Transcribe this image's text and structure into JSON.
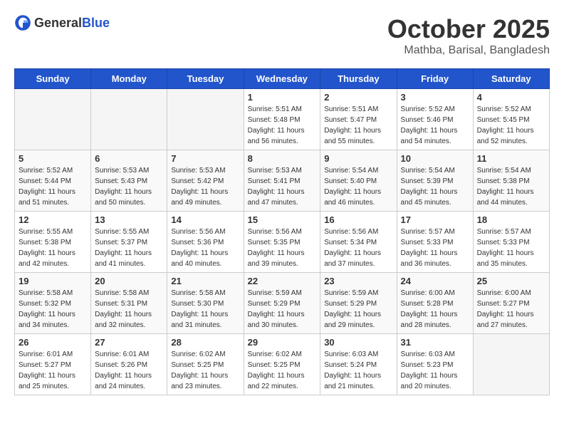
{
  "header": {
    "logo_general": "General",
    "logo_blue": "Blue",
    "month_year": "October 2025",
    "location": "Mathba, Barisal, Bangladesh"
  },
  "days_of_week": [
    "Sunday",
    "Monday",
    "Tuesday",
    "Wednesday",
    "Thursday",
    "Friday",
    "Saturday"
  ],
  "weeks": [
    [
      {
        "day": "",
        "info": ""
      },
      {
        "day": "",
        "info": ""
      },
      {
        "day": "",
        "info": ""
      },
      {
        "day": "1",
        "info": "Sunrise: 5:51 AM\nSunset: 5:48 PM\nDaylight: 11 hours\nand 56 minutes."
      },
      {
        "day": "2",
        "info": "Sunrise: 5:51 AM\nSunset: 5:47 PM\nDaylight: 11 hours\nand 55 minutes."
      },
      {
        "day": "3",
        "info": "Sunrise: 5:52 AM\nSunset: 5:46 PM\nDaylight: 11 hours\nand 54 minutes."
      },
      {
        "day": "4",
        "info": "Sunrise: 5:52 AM\nSunset: 5:45 PM\nDaylight: 11 hours\nand 52 minutes."
      }
    ],
    [
      {
        "day": "5",
        "info": "Sunrise: 5:52 AM\nSunset: 5:44 PM\nDaylight: 11 hours\nand 51 minutes."
      },
      {
        "day": "6",
        "info": "Sunrise: 5:53 AM\nSunset: 5:43 PM\nDaylight: 11 hours\nand 50 minutes."
      },
      {
        "day": "7",
        "info": "Sunrise: 5:53 AM\nSunset: 5:42 PM\nDaylight: 11 hours\nand 49 minutes."
      },
      {
        "day": "8",
        "info": "Sunrise: 5:53 AM\nSunset: 5:41 PM\nDaylight: 11 hours\nand 47 minutes."
      },
      {
        "day": "9",
        "info": "Sunrise: 5:54 AM\nSunset: 5:40 PM\nDaylight: 11 hours\nand 46 minutes."
      },
      {
        "day": "10",
        "info": "Sunrise: 5:54 AM\nSunset: 5:39 PM\nDaylight: 11 hours\nand 45 minutes."
      },
      {
        "day": "11",
        "info": "Sunrise: 5:54 AM\nSunset: 5:38 PM\nDaylight: 11 hours\nand 44 minutes."
      }
    ],
    [
      {
        "day": "12",
        "info": "Sunrise: 5:55 AM\nSunset: 5:38 PM\nDaylight: 11 hours\nand 42 minutes."
      },
      {
        "day": "13",
        "info": "Sunrise: 5:55 AM\nSunset: 5:37 PM\nDaylight: 11 hours\nand 41 minutes."
      },
      {
        "day": "14",
        "info": "Sunrise: 5:56 AM\nSunset: 5:36 PM\nDaylight: 11 hours\nand 40 minutes."
      },
      {
        "day": "15",
        "info": "Sunrise: 5:56 AM\nSunset: 5:35 PM\nDaylight: 11 hours\nand 39 minutes."
      },
      {
        "day": "16",
        "info": "Sunrise: 5:56 AM\nSunset: 5:34 PM\nDaylight: 11 hours\nand 37 minutes."
      },
      {
        "day": "17",
        "info": "Sunrise: 5:57 AM\nSunset: 5:33 PM\nDaylight: 11 hours\nand 36 minutes."
      },
      {
        "day": "18",
        "info": "Sunrise: 5:57 AM\nSunset: 5:33 PM\nDaylight: 11 hours\nand 35 minutes."
      }
    ],
    [
      {
        "day": "19",
        "info": "Sunrise: 5:58 AM\nSunset: 5:32 PM\nDaylight: 11 hours\nand 34 minutes."
      },
      {
        "day": "20",
        "info": "Sunrise: 5:58 AM\nSunset: 5:31 PM\nDaylight: 11 hours\nand 32 minutes."
      },
      {
        "day": "21",
        "info": "Sunrise: 5:58 AM\nSunset: 5:30 PM\nDaylight: 11 hours\nand 31 minutes."
      },
      {
        "day": "22",
        "info": "Sunrise: 5:59 AM\nSunset: 5:29 PM\nDaylight: 11 hours\nand 30 minutes."
      },
      {
        "day": "23",
        "info": "Sunrise: 5:59 AM\nSunset: 5:29 PM\nDaylight: 11 hours\nand 29 minutes."
      },
      {
        "day": "24",
        "info": "Sunrise: 6:00 AM\nSunset: 5:28 PM\nDaylight: 11 hours\nand 28 minutes."
      },
      {
        "day": "25",
        "info": "Sunrise: 6:00 AM\nSunset: 5:27 PM\nDaylight: 11 hours\nand 27 minutes."
      }
    ],
    [
      {
        "day": "26",
        "info": "Sunrise: 6:01 AM\nSunset: 5:27 PM\nDaylight: 11 hours\nand 25 minutes."
      },
      {
        "day": "27",
        "info": "Sunrise: 6:01 AM\nSunset: 5:26 PM\nDaylight: 11 hours\nand 24 minutes."
      },
      {
        "day": "28",
        "info": "Sunrise: 6:02 AM\nSunset: 5:25 PM\nDaylight: 11 hours\nand 23 minutes."
      },
      {
        "day": "29",
        "info": "Sunrise: 6:02 AM\nSunset: 5:25 PM\nDaylight: 11 hours\nand 22 minutes."
      },
      {
        "day": "30",
        "info": "Sunrise: 6:03 AM\nSunset: 5:24 PM\nDaylight: 11 hours\nand 21 minutes."
      },
      {
        "day": "31",
        "info": "Sunrise: 6:03 AM\nSunset: 5:23 PM\nDaylight: 11 hours\nand 20 minutes."
      },
      {
        "day": "",
        "info": ""
      }
    ]
  ]
}
